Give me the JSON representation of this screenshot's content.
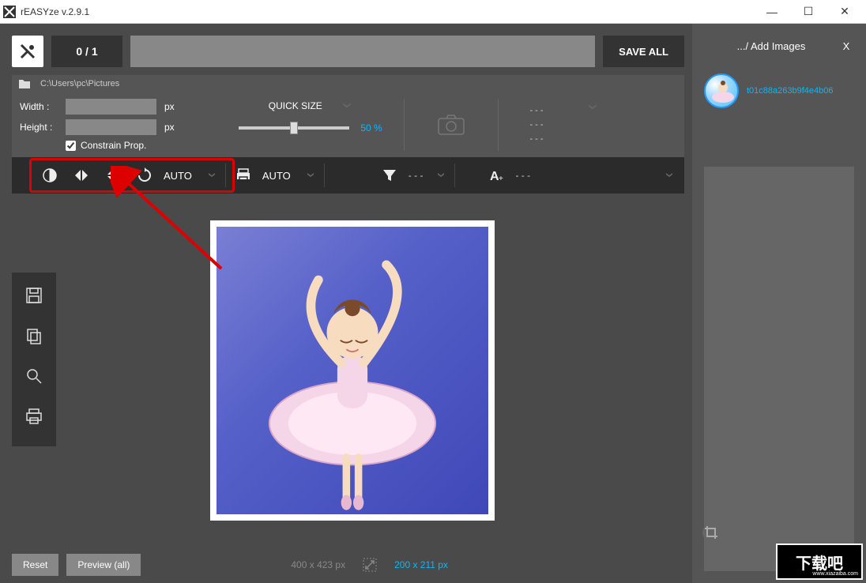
{
  "window": {
    "title": "rEASYze v.2.9.1",
    "minimize": "—",
    "maximize": "☐",
    "close": "✕"
  },
  "top": {
    "counter": "0 / 1",
    "save_all": "SAVE ALL"
  },
  "path": {
    "value": "C:\\Users\\pc\\Pictures"
  },
  "dimensions": {
    "width_label": "Width :",
    "width_value": "",
    "height_label": "Height :",
    "height_value": "",
    "unit": "px",
    "constrain_label": "Constrain Prop."
  },
  "quick": {
    "label": "QUICK SIZE",
    "percent": "50 %"
  },
  "dashes": {
    "d1": "- - -",
    "d2": "- - -",
    "d3": "- - -"
  },
  "toolbar": {
    "auto1": "AUTO",
    "auto2": "AUTO",
    "dash1": "- - -",
    "dash2": "- - -"
  },
  "footer": {
    "reset": "Reset",
    "preview_all": "Preview (all)",
    "orig_dim": "400 x 423 px",
    "new_dim": "200 x 211 px"
  },
  "sidebar": {
    "add_images": ".../ Add Images",
    "close_x": "X",
    "thumb_name": "t01c88a263b9f4e4b06"
  },
  "watermark": {
    "text": "下载吧",
    "url": "www.xiazaiba.com"
  }
}
